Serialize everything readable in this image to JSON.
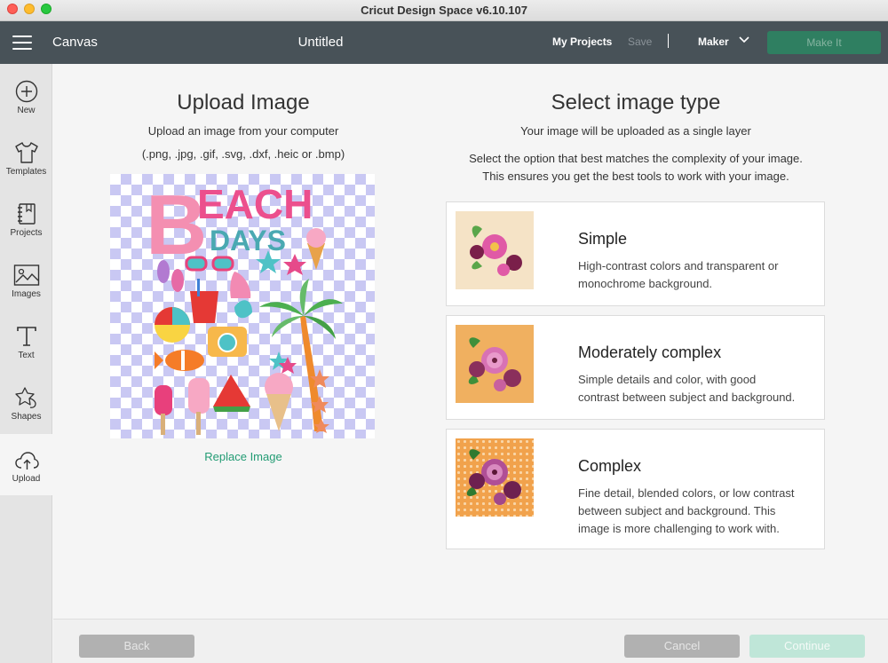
{
  "window": {
    "title": "Cricut Design Space  v6.10.107"
  },
  "header": {
    "canvas_label": "Canvas",
    "project_title": "Untitled",
    "my_projects": "My Projects",
    "save": "Save",
    "separator": "|",
    "machine": "Maker",
    "make_it": "Make It"
  },
  "sidebar": {
    "items": [
      {
        "label": "New",
        "icon": "plus-circle-icon"
      },
      {
        "label": "Templates",
        "icon": "tshirt-icon"
      },
      {
        "label": "Projects",
        "icon": "notebook-icon"
      },
      {
        "label": "Images",
        "icon": "image-icon"
      },
      {
        "label": "Text",
        "icon": "text-icon"
      },
      {
        "label": "Shapes",
        "icon": "shapes-icon"
      },
      {
        "label": "Upload",
        "icon": "cloud-upload-icon",
        "active": true
      }
    ]
  },
  "upload": {
    "title": "Upload Image",
    "subtitle": "Upload an image from your computer",
    "formats": "(.png, .jpg, .gif, .svg, .dxf, .heic or .bmp)",
    "preview_text_line1": "EACH",
    "preview_letter_b": "B",
    "preview_text_line2": "DAYS",
    "replace_label": "Replace Image"
  },
  "image_type": {
    "title": "Select image type",
    "subtitle": "Your image will be uploaded as a single layer",
    "description_line1": "Select the option that best matches the complexity of your image.",
    "description_line2": "This ensures you get the best tools to work with your image.",
    "options": [
      {
        "title": "Simple",
        "desc_line1": "High-contrast colors and transparent or",
        "desc_line2": "monochrome background."
      },
      {
        "title": "Moderately complex",
        "desc_line1": "Simple details and color, with good",
        "desc_line2": "contrast between subject and background."
      },
      {
        "title": "Complex",
        "desc_line1": "Fine detail, blended colors, or low contrast",
        "desc_line2": "between subject and background. This",
        "desc_line3": "image is more challenging to work with."
      }
    ]
  },
  "footer": {
    "back": "Back",
    "cancel": "Cancel",
    "continue": "Continue"
  },
  "colors": {
    "appbar": "#485258",
    "accent_green": "#239c74",
    "make_it_bg": "#2f7f61",
    "checker": "#c9c8f3"
  }
}
